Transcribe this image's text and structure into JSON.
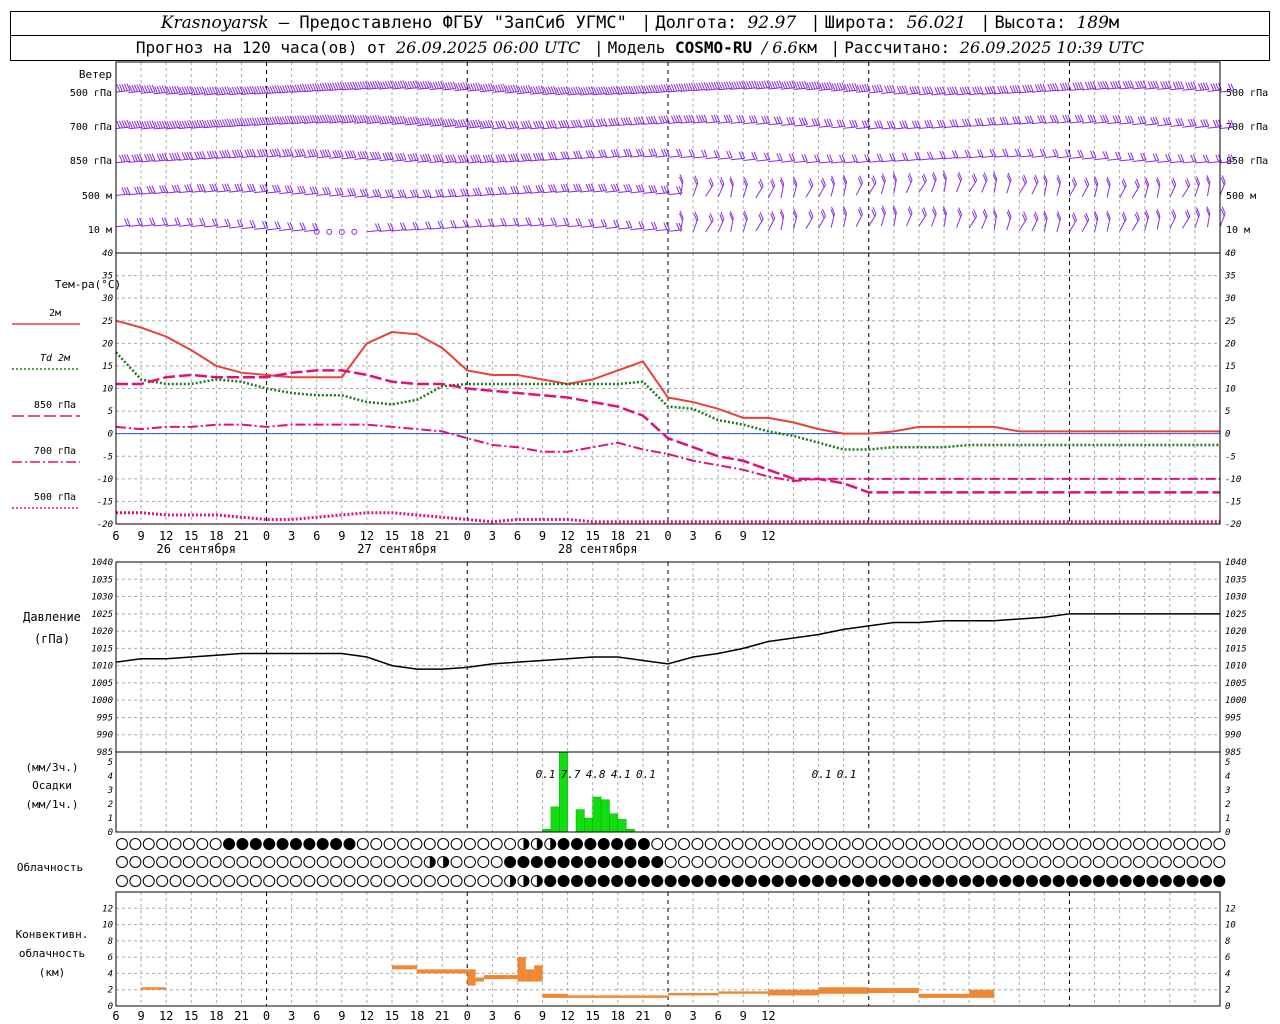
{
  "header": {
    "station": "Krasnoyarsk",
    "provider": "— Предоставлено ФГБУ \"ЗапСиб УГМС\"",
    "lon_label": "Долгота:",
    "lon": "92.97",
    "lat_label": "Широта:",
    "lat": "56.021",
    "alt_label": "Высота:",
    "alt": "189",
    "alt_unit": "м",
    "forecast_prefix": "Прогноз на 120 часа(ов) от",
    "forecast_time": "26.09.2025 06:00 UTC",
    "model_label": "Модель",
    "model": "COSMO-RU",
    "model_res": "/ 6.6",
    "model_res_unit": "км",
    "calc_label": "Рассчитано:",
    "calc_time": "26.09.2025 10:39 UTC"
  },
  "panels": {
    "wind": {
      "title": "Ветер",
      "levels": [
        "500 гПа",
        "700 гПа",
        "850 гПа",
        "500 м",
        "10  м"
      ]
    },
    "temp": {
      "title": "Тем-ра(°C)",
      "legend": [
        "2м",
        "Td  2м",
        "850 гПа",
        "700 гПа",
        "500 гПа"
      ]
    },
    "pressure": {
      "title1": "Давление",
      "title2": "(гПа)"
    },
    "precip": {
      "title1": "(мм/3ч.)",
      "title2": "Осадки",
      "title3": "(мм/1ч.)"
    },
    "cloud": {
      "title": "Облачность"
    },
    "conv": {
      "title1": "Конвективн.",
      "title2": "облачность",
      "title3": "(км)"
    }
  },
  "x_ticks": [
    "6",
    "9",
    "12",
    "15",
    "18",
    "21",
    "0",
    "3",
    "6",
    "9",
    "12",
    "15",
    "18",
    "21",
    "0",
    "3",
    "6",
    "9",
    "12",
    "15",
    "18",
    "21",
    "0",
    "3",
    "6",
    "9",
    "12"
  ],
  "day_labels": [
    "26 сентября",
    "27 сентября",
    "28 сентября"
  ],
  "colors": {
    "t2m": "#e8403a",
    "td2m": "#1a7a1a",
    "t850": "#e0107a",
    "t700": "#e0107a",
    "t500": "#e0107a",
    "wind": "#8a2be2",
    "precip": "#11dd11",
    "conv": "#ee8833",
    "pressure": "#000000"
  },
  "chart_data": [
    {
      "type": "line",
      "title": "Тем-ра(°C)",
      "ylim": [
        -20,
        40
      ],
      "y_ticks": [
        "40",
        "35",
        "30",
        "25",
        "20",
        "15",
        "10",
        "5",
        "0",
        "-5",
        "-10",
        "-15",
        "-20"
      ],
      "x_hours": [
        0,
        3,
        6,
        9,
        12,
        15,
        18,
        21,
        24,
        27,
        30,
        33,
        36,
        39,
        42,
        45,
        48,
        51,
        54,
        57,
        60,
        63,
        66,
        69,
        72,
        75,
        78,
        81,
        84,
        87,
        90,
        93,
        96,
        99,
        102,
        105,
        108,
        111,
        114,
        117,
        120,
        123,
        126,
        129,
        132
      ],
      "series": [
        {
          "name": "2м",
          "values": [
            25,
            23.5,
            21.5,
            18.5,
            15,
            13.5,
            13,
            12.5,
            12.5,
            12.5,
            20,
            22.5,
            22,
            19,
            14,
            13,
            13,
            12,
            11,
            12,
            14,
            16,
            8,
            7,
            5.5,
            3.5,
            3.5,
            2.5,
            1,
            0,
            0,
            0.5,
            1.5,
            1.5,
            1.5,
            1.5,
            0.5,
            0.5,
            0.5,
            0.5,
            0.5,
            0.5,
            0.5,
            0.5,
            0.5
          ]
        },
        {
          "name": "Td  2м",
          "values": [
            18,
            12,
            11,
            11,
            12,
            11.5,
            10,
            9,
            8.5,
            8.5,
            7,
            6.5,
            7.5,
            10.5,
            11,
            11,
            11,
            11,
            11,
            11,
            11,
            11.5,
            6,
            5.5,
            3,
            2,
            0.5,
            -0.5,
            -2,
            -3.5,
            -3.5,
            -3,
            -3,
            -3,
            -2.5,
            -2.5,
            -2.5,
            -2.5,
            -2.5,
            -2.5,
            -2.5,
            -2.5,
            -2.5,
            -2.5,
            -2.5
          ]
        },
        {
          "name": "850 гПа",
          "values": [
            11,
            11,
            12.5,
            13,
            12.5,
            12.5,
            12.5,
            13.5,
            14,
            14,
            13,
            11.5,
            11,
            11,
            10,
            9.5,
            9,
            8.5,
            8,
            7,
            6,
            4,
            -1,
            -3,
            -5,
            -6,
            -8,
            -10,
            -10,
            -11,
            -13,
            -13,
            -13,
            -13,
            -13,
            -13,
            -13,
            -13,
            -13,
            -13,
            -13,
            -13,
            -13,
            -13,
            -13
          ]
        },
        {
          "name": "700 гПа",
          "values": [
            1.5,
            1,
            1.5,
            1.5,
            2,
            2,
            1.5,
            2,
            2,
            2,
            2,
            1.5,
            1,
            0.5,
            -1,
            -2.5,
            -3,
            -4,
            -4,
            -3,
            -2,
            -3.5,
            -4.5,
            -6,
            -7,
            -8,
            -9.5,
            -10.5,
            -10,
            -10,
            -10,
            -10,
            -10,
            -10,
            -10,
            -10,
            -10,
            -10,
            -10,
            -10,
            -10,
            -10,
            -10,
            -10,
            -10
          ]
        },
        {
          "name": "500 гПа",
          "values": [
            -17.5,
            -17.5,
            -18,
            -18,
            -18,
            -18.5,
            -19,
            -19,
            -18.5,
            -18,
            -17.5,
            -17.5,
            -18,
            -18.5,
            -19,
            -19.5,
            -19,
            -19,
            -19,
            -19.5,
            -19.5,
            -19.5,
            -19.5,
            -19.5,
            -19.5,
            -19.5,
            -19.5,
            -19.5,
            -19.5,
            -19.5,
            -19.5,
            -19.5,
            -19.5,
            -19.5,
            -19.5,
            -19.5,
            -19.5,
            -19.5,
            -19.5,
            -19.5,
            -19.5,
            -19.5,
            -19.5,
            -19.5,
            -19.5
          ]
        }
      ]
    },
    {
      "type": "line",
      "title": "Давление (гПа)",
      "ylim": [
        985,
        1040
      ],
      "y_ticks": [
        "1040",
        "1035",
        "1030",
        "1025",
        "1020",
        "1015",
        "1010",
        "1005",
        "1000",
        "995",
        "990",
        "985"
      ],
      "x_hours": [
        0,
        3,
        6,
        9,
        12,
        15,
        18,
        21,
        24,
        27,
        30,
        33,
        36,
        39,
        42,
        45,
        48,
        51,
        54,
        57,
        60,
        63,
        66,
        69,
        72,
        75,
        78,
        81,
        84,
        87,
        90,
        93,
        96,
        99,
        102,
        105,
        108,
        111,
        114,
        117,
        120,
        123,
        126,
        129,
        132
      ],
      "series": [
        {
          "name": "",
          "values": [
            1011,
            1012,
            1012,
            1012.5,
            1013,
            1013.5,
            1013.5,
            1013.5,
            1013.5,
            1013.5,
            1012.5,
            1010,
            1009,
            1009,
            1009.5,
            1010.5,
            1011,
            1011.5,
            1012,
            1012.5,
            1012.5,
            1011.5,
            1010.5,
            1012.5,
            1013.5,
            1015,
            1017,
            1018,
            1019,
            1020.5,
            1021.5,
            1022.5,
            1022.5,
            1023,
            1023,
            1023,
            1023.5,
            1024,
            1025,
            1025,
            1025,
            1025,
            1025,
            1025,
            1025
          ]
        }
      ]
    },
    {
      "type": "bar",
      "title": "Осадки",
      "ylim": [
        0,
        5
      ],
      "y_ticks": [
        "5",
        "4",
        "3",
        "2",
        "1",
        "0"
      ],
      "labels_3h": [
        {
          "hour": 51,
          "value": "0.1"
        },
        {
          "hour": 54,
          "value": "7.7"
        },
        {
          "hour": 57,
          "value": "4.8"
        },
        {
          "hour": 60,
          "value": "4.1"
        },
        {
          "hour": 63,
          "value": "0.1"
        },
        {
          "hour": 84,
          "value": "0.1"
        },
        {
          "hour": 87,
          "value": "0.1"
        }
      ],
      "bars_1h": [
        {
          "hour": 51,
          "value": 0.2
        },
        {
          "hour": 52,
          "value": 1.8
        },
        {
          "hour": 53,
          "value": 5.9
        },
        {
          "hour": 55,
          "value": 1.6
        },
        {
          "hour": 56,
          "value": 1
        },
        {
          "hour": 57,
          "value": 2.5
        },
        {
          "hour": 58,
          "value": 2.3
        },
        {
          "hour": 59,
          "value": 1.3
        },
        {
          "hour": 60,
          "value": 0.9
        },
        {
          "hour": 61,
          "value": 0.2
        }
      ]
    },
    {
      "type": "bar",
      "title": "Конвективн. облачность (км)",
      "ylim": [
        0,
        14
      ],
      "y_ticks": [
        "12",
        "10",
        "8",
        "6",
        "4",
        "2",
        "0"
      ],
      "bars": [
        {
          "hour": 3,
          "bottom": 2,
          "top": 2.3
        },
        {
          "hour": 33,
          "bottom": 4.5,
          "top": 5
        },
        {
          "hour": 36,
          "bottom": 4,
          "top": 4.5
        },
        {
          "hour": 42,
          "bottom": 2.5,
          "top": 4.5
        },
        {
          "hour": 43,
          "bottom": 3,
          "top": 3.5
        },
        {
          "hour": 44,
          "bottom": 3.3,
          "top": 3.8
        },
        {
          "hour": 47,
          "bottom": 3.3,
          "top": 3.8
        },
        {
          "hour": 48,
          "bottom": 3,
          "top": 6
        },
        {
          "hour": 49,
          "bottom": 3,
          "top": 4.5
        },
        {
          "hour": 50,
          "bottom": 3,
          "top": 5
        },
        {
          "hour": 51,
          "bottom": 1,
          "top": 1.5
        },
        {
          "hour": 54,
          "bottom": 1,
          "top": 1.3
        },
        {
          "hour": 60,
          "bottom": 1,
          "top": 1.3
        },
        {
          "hour": 66,
          "bottom": 1.3,
          "top": 1.6
        },
        {
          "hour": 72,
          "bottom": 1.5,
          "top": 1.8
        },
        {
          "hour": 78,
          "bottom": 1.3,
          "top": 2
        },
        {
          "hour": 84,
          "bottom": 1.5,
          "top": 2.3
        },
        {
          "hour": 90,
          "bottom": 1.6,
          "top": 2.2
        },
        {
          "hour": 96,
          "bottom": 1,
          "top": 1.5
        },
        {
          "hour": 102,
          "bottom": 1,
          "top": 2
        }
      ]
    }
  ]
}
